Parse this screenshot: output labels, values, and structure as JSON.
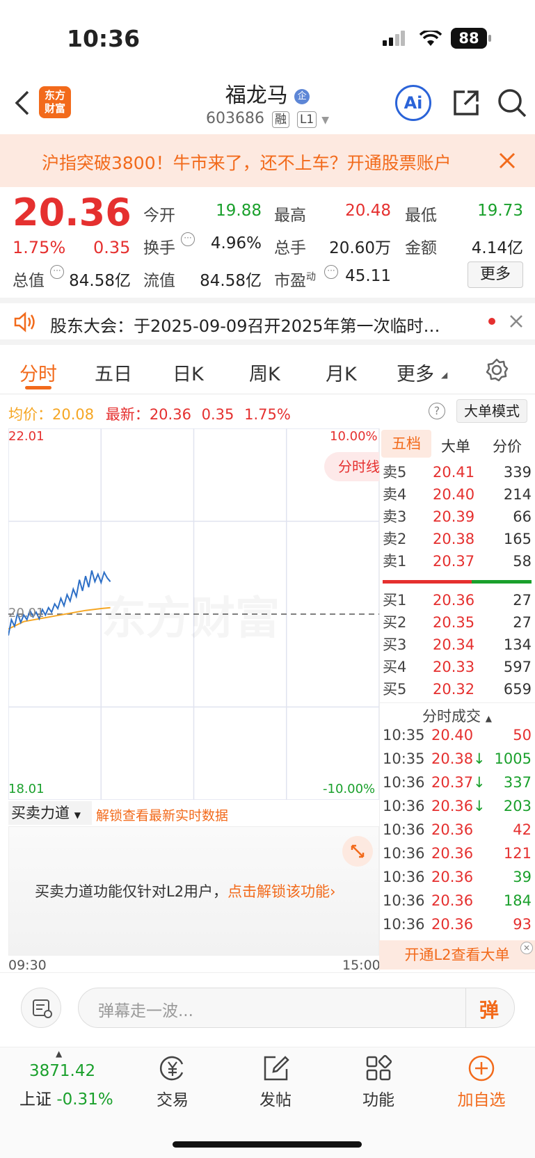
{
  "status": {
    "time": "10:36",
    "battery": "88"
  },
  "header": {
    "logo_line1": "东方",
    "logo_line2": "财富",
    "title": "福龙马",
    "badge": "企",
    "code": "603686",
    "tag1": "融",
    "tag2": "L1",
    "ai_label": "Ai"
  },
  "banner": {
    "text": "沪指突破3800！牛市来了，还不上车？开通股票账户"
  },
  "quote": {
    "price": "20.36",
    "change_pct": "1.75%",
    "change": "0.35",
    "open_label": "今开",
    "open": "19.88",
    "high_label": "最高",
    "high": "20.48",
    "low_label": "最低",
    "low": "19.73",
    "turnover_label": "换手",
    "turnover": "4.96%",
    "volume_label": "总手",
    "volume": "20.60万",
    "amount_label": "金额",
    "amount": "4.14亿",
    "mktcap_label": "总值",
    "mktcap": "84.58亿",
    "float_label": "流值",
    "float": "84.58亿",
    "pe_label": "市盈",
    "pe_sup": "动",
    "pe": "45.11",
    "more_label": "更多"
  },
  "notice": {
    "text": "股东大会：于2025-09-09召开2025年第一次临时…"
  },
  "tabs": [
    "分时",
    "五日",
    "日K",
    "周K",
    "月K",
    "更多"
  ],
  "chart_header": {
    "avg_label": "均价：",
    "avg": "20.08",
    "latest_label": "最新：",
    "latest": "20.36",
    "latest_chg": "0.35",
    "latest_pct": "1.75%",
    "mode_btn": "大单模式"
  },
  "chart_labels": {
    "ymax": "22.01",
    "ymin": "18.01",
    "ymid": "20.01",
    "pmax": "10.00%",
    "pmin": "-10.00%",
    "xstart": "09:30",
    "xend": "15:00",
    "float_btn": "分时线",
    "watermark": "东方财富"
  },
  "chart_data": {
    "type": "line",
    "title": "",
    "xlabel": "",
    "ylabel": "",
    "ylim": [
      18.01,
      22.01
    ],
    "prev_close": 20.01,
    "series": [
      {
        "name": "",
        "color": "#2d6fc6",
        "x": [
          "09:30",
          "09:32",
          "09:34",
          "09:36",
          "09:38",
          "09:40",
          "09:42",
          "09:44",
          "09:46",
          "09:48",
          "09:50",
          "09:52",
          "09:54",
          "09:56",
          "09:58",
          "10:00",
          "10:02",
          "10:04",
          "10:06",
          "10:08",
          "10:10",
          "10:12",
          "10:14",
          "10:16",
          "10:18",
          "10:20",
          "10:22",
          "10:24",
          "10:26",
          "10:28",
          "10:30",
          "10:32",
          "10:34",
          "10:36"
        ],
        "values": [
          19.78,
          19.95,
          19.88,
          20.02,
          19.92,
          20.0,
          19.95,
          20.05,
          19.98,
          20.03,
          19.96,
          20.06,
          20.0,
          20.08,
          20.03,
          20.12,
          20.07,
          20.18,
          20.1,
          20.22,
          20.15,
          20.28,
          20.2,
          20.38,
          20.26,
          20.42,
          20.3,
          20.48,
          20.36,
          20.44,
          20.35,
          20.46,
          20.4,
          20.36
        ]
      },
      {
        "name": "",
        "color": "#f5a623",
        "x": [
          "09:30",
          "09:40",
          "09:50",
          "10:00",
          "10:10",
          "10:20",
          "10:30",
          "10:36"
        ],
        "values": [
          19.85,
          19.93,
          19.96,
          19.99,
          20.02,
          20.05,
          20.07,
          20.08
        ]
      }
    ]
  },
  "force_panel": {
    "dropdown": "买卖力道",
    "unlock_link": "解锁查看最新实时数据",
    "msg": "买卖力道功能仅针对L2用户，",
    "msg_link": "点击解锁该功能"
  },
  "orderbook": {
    "tabs": [
      "五档",
      "大单",
      "分价"
    ],
    "asks": [
      {
        "label": "卖5",
        "price": "20.41",
        "vol": "339"
      },
      {
        "label": "卖4",
        "price": "20.40",
        "vol": "214"
      },
      {
        "label": "卖3",
        "price": "20.39",
        "vol": "66"
      },
      {
        "label": "卖2",
        "price": "20.38",
        "vol": "165"
      },
      {
        "label": "卖1",
        "price": "20.37",
        "vol": "58"
      }
    ],
    "bids": [
      {
        "label": "买1",
        "price": "20.36",
        "vol": "27"
      },
      {
        "label": "买2",
        "price": "20.35",
        "vol": "27"
      },
      {
        "label": "买3",
        "price": "20.34",
        "vol": "134"
      },
      {
        "label": "买4",
        "price": "20.33",
        "vol": "597"
      },
      {
        "label": "买5",
        "price": "20.32",
        "vol": "659"
      }
    ],
    "buy_ratio": 0.6,
    "ticks_header": "分时成交",
    "ticks": [
      {
        "time": "10:35",
        "price": "20.40",
        "arrow": "",
        "vol": "50",
        "color": "red"
      },
      {
        "time": "10:35",
        "price": "20.38",
        "arrow": "↓",
        "vol": "1005",
        "color": "green"
      },
      {
        "time": "10:36",
        "price": "20.37",
        "arrow": "↓",
        "vol": "337",
        "color": "green"
      },
      {
        "time": "10:36",
        "price": "20.36",
        "arrow": "↓",
        "vol": "203",
        "color": "green"
      },
      {
        "time": "10:36",
        "price": "20.36",
        "arrow": "",
        "vol": "42",
        "color": "red"
      },
      {
        "time": "10:36",
        "price": "20.36",
        "arrow": "",
        "vol": "121",
        "color": "red"
      },
      {
        "time": "10:36",
        "price": "20.36",
        "arrow": "",
        "vol": "39",
        "color": "green"
      },
      {
        "time": "10:36",
        "price": "20.36",
        "arrow": "",
        "vol": "184",
        "color": "green"
      },
      {
        "time": "10:36",
        "price": "20.36",
        "arrow": "",
        "vol": "93",
        "color": "red"
      }
    ],
    "l2_banner": "开通L2查看大单"
  },
  "comment": {
    "placeholder": "弹幕走一波...",
    "danmu_label": "弹"
  },
  "bottom_nav": {
    "index_value": "3871.42",
    "index_name": "上证",
    "index_change": "-0.31%",
    "items": [
      {
        "label": "交易",
        "icon": "yen-icon"
      },
      {
        "label": "发帖",
        "icon": "edit-icon"
      },
      {
        "label": "功能",
        "icon": "grid-icon"
      },
      {
        "label": "加自选",
        "icon": "plus-circle-icon"
      }
    ]
  },
  "colors": {
    "up": "#e5302f",
    "down": "#1aa02c",
    "accent": "#f26a1b",
    "price_line": "#2d6fc6",
    "avg_line": "#f5a623"
  }
}
